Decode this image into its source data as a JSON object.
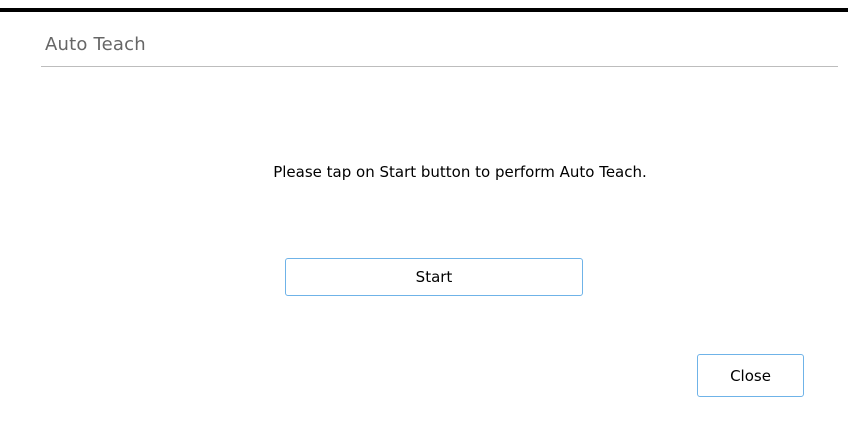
{
  "dialog": {
    "title": "Auto Teach",
    "instruction": "Please tap on Start button to perform Auto Teach.",
    "start_label": "Start",
    "close_label": "Close"
  },
  "colors": {
    "button_border": "#6fb3e8",
    "title_text": "#666666",
    "top_border": "#000000"
  }
}
